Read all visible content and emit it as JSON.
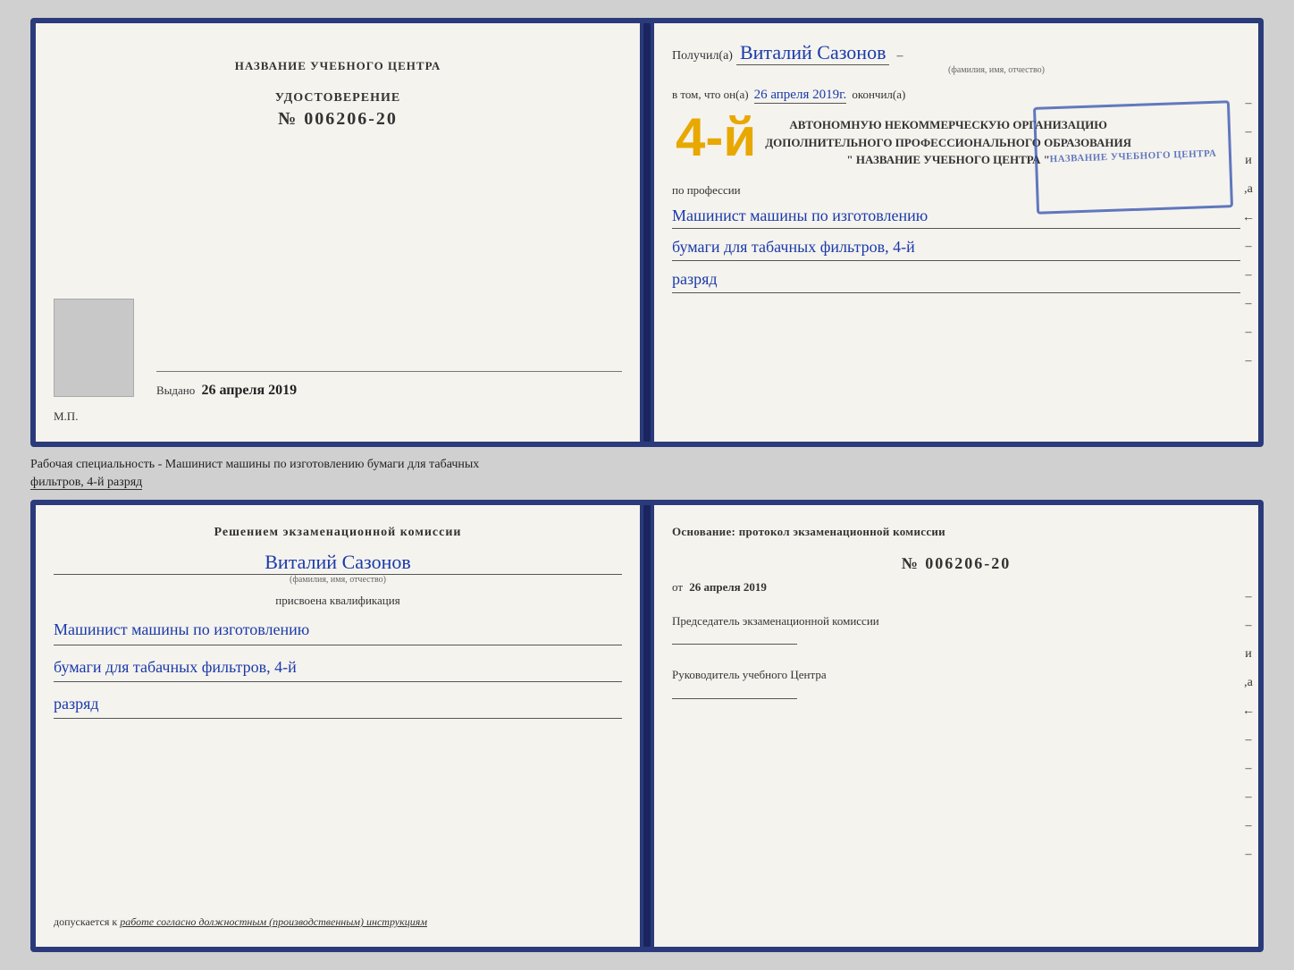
{
  "top_book": {
    "left_page": {
      "school_label": "НАЗВАНИЕ УЧЕБНОГО ЦЕНТРА",
      "cert_label": "УДОСТОВЕРЕНИЕ",
      "cert_number": "№ 006206-20",
      "vydano_label": "Выдано",
      "vydano_date": "26 апреля 2019",
      "mp_label": "М.П."
    },
    "right_page": {
      "poluchil_prefix": "Получил(а)",
      "recipient_name": "Виталий Сазонов",
      "fio_sublabel": "(фамилия, имя, отчество)",
      "dash": "–",
      "v_tom_prefix": "в том, что он(а)",
      "date_handwritten": "26 апреля 2019г.",
      "okonchil": "окончил(а)",
      "big_number": "4-й",
      "org_line1": "АВТОНОМНУЮ НЕКОММЕРЧЕСКУЮ ОРГАНИЗАЦИЮ",
      "org_line2": "ДОПОЛНИТЕЛЬНОГО ПРОФЕССИОНАЛЬНОГО ОБРАЗОВАНИЯ",
      "org_line3": "\" НАЗВАНИЕ УЧЕБНОГО ЦЕНТРА \"",
      "po_professii": "по профессии",
      "profession_line1": "Машинист машины по изготовлению",
      "profession_line2": "бумаги для табачных фильтров, 4-й",
      "profession_line3": "разряд",
      "stamp_text": "НАЗВАНИЕ УЧЕБНОГО ЦЕНТРА"
    }
  },
  "specialty_text": "Рабочая специальность - Машинист машины по изготовлению бумаги для табачных",
  "specialty_underline": "фильтров, 4-й разряд",
  "bottom_book": {
    "left_page": {
      "resheniem": "Решением экзаменационной комиссии",
      "name_handwritten": "Виталий Сазонов",
      "fio_sublabel": "(фамилия, имя, отчество)",
      "prisvoena": "присвоена квалификация",
      "qual_line1": "Машинист машины по изготовлению",
      "qual_line2": "бумаги для табачных фильтров, 4-й",
      "qual_line3": "разряд",
      "dopuskaetsya_prefix": "допускается к",
      "dopuskaetsya_text": "работе согласно должностным (производственным) инструкциям"
    },
    "right_page": {
      "osnovanie_label": "Основание: протокол экзаменационной комиссии",
      "protocol_number": "№ 006206-20",
      "ot_prefix": "от",
      "ot_date": "26 апреля 2019",
      "predsedatel_label": "Председатель экзаменационной комиссии",
      "rukovoditel_label": "Руководитель учебного Центра"
    }
  },
  "right_edge": {
    "marks": [
      "–",
      "–",
      "и",
      ",а",
      "←",
      "–",
      "–",
      "–",
      "–",
      "–"
    ]
  }
}
